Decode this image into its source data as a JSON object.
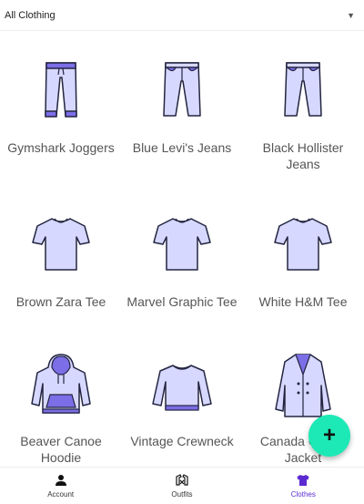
{
  "filter": {
    "selected": "All Clothing",
    "caret_icon": "dropdown-caret-icon"
  },
  "items": [
    {
      "label": "Gymshark Joggers",
      "icon": "joggers-icon"
    },
    {
      "label": "Blue Levi's Jeans",
      "icon": "jeans-icon"
    },
    {
      "label": "Black Hollister Jeans",
      "icon": "jeans-icon"
    },
    {
      "label": "Brown Zara Tee",
      "icon": "tshirt-icon"
    },
    {
      "label": "Marvel Graphic Tee",
      "icon": "tshirt-icon"
    },
    {
      "label": "White H&M Tee",
      "icon": "tshirt-icon"
    },
    {
      "label": "Beaver Canoe Hoodie",
      "icon": "hoodie-icon"
    },
    {
      "label": "Vintage Crewneck",
      "icon": "crewneck-icon"
    },
    {
      "label": "Canada Goose Jacket",
      "icon": "jacket-icon"
    }
  ],
  "fab": {
    "label": "+",
    "icon": "add-icon"
  },
  "nav": [
    {
      "label": "Account",
      "icon": "account-icon",
      "active": false
    },
    {
      "label": "Outfits",
      "icon": "outfits-icon",
      "active": false
    },
    {
      "label": "Clothes",
      "icon": "clothes-icon",
      "active": true
    }
  ],
  "colors": {
    "garment_fill": "#d6d8ff",
    "garment_accent": "#7b6ee6",
    "garment_outline": "#232540",
    "fab": "#1de9b6",
    "nav_active": "#5b2ad1"
  }
}
